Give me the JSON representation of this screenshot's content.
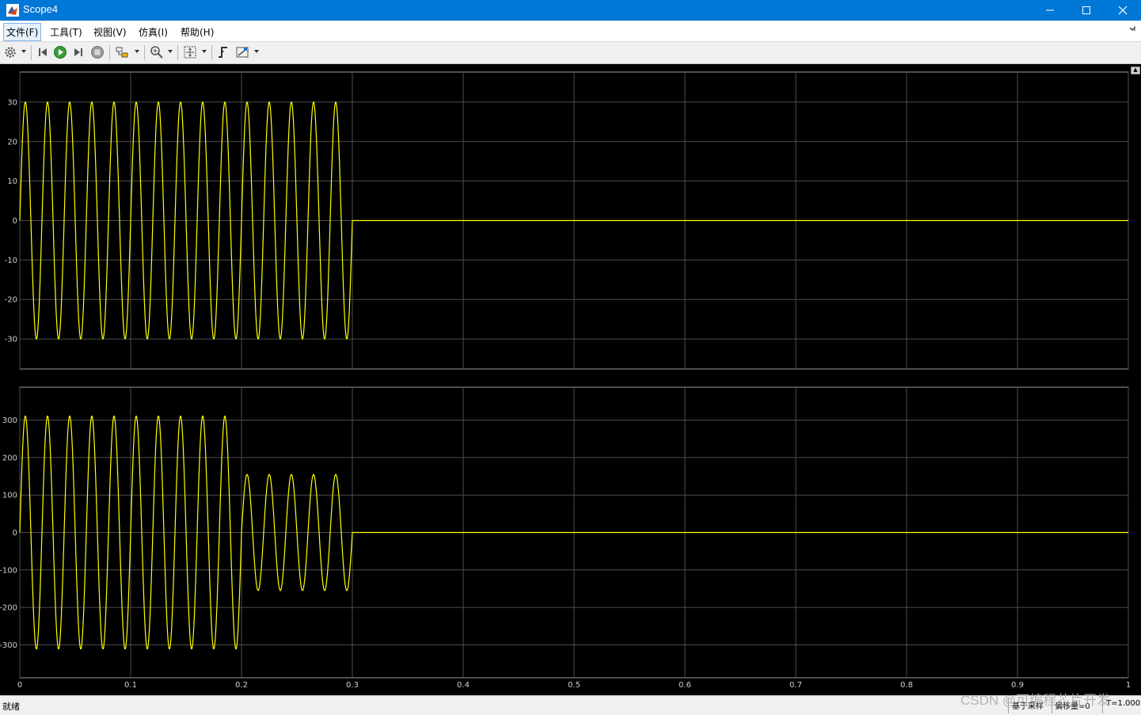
{
  "window": {
    "title": "Scope4"
  },
  "menu": [
    {
      "label": "文件(F)"
    },
    {
      "label": "工具(T)"
    },
    {
      "label": "视图(V)"
    },
    {
      "label": "仿真(I)"
    },
    {
      "label": "帮助(H)"
    }
  ],
  "toolbar": {
    "icons": [
      "gear-icon",
      "step-back-icon",
      "run-icon",
      "step-forward-icon",
      "stop-icon",
      "highlight-block-icon",
      "zoom-icon",
      "fit-to-view-icon",
      "triggers-icon",
      "measurements-icon"
    ]
  },
  "colors": {
    "signal": "#ffff00",
    "plot_bg": "#000000",
    "grid": "#4d4d4d",
    "axis_text": "#d0d0d0",
    "titlebar": "#0078d7"
  },
  "plots": [
    {
      "x_ticks": [
        "0",
        "0.1",
        "0.2",
        "0.3",
        "0.4",
        "0.5",
        "0.6",
        "0.7",
        "0.8",
        "0.9",
        "1"
      ],
      "y_ticks": [
        "30",
        "20",
        "10",
        "0",
        "-10",
        "-20",
        "-30"
      ],
      "xlim": [
        0,
        1
      ],
      "ylim": [
        -37.6,
        37.6
      ],
      "grid": true,
      "signal": {
        "frequency_hz": 50,
        "segments": [
          {
            "t0": 0,
            "t1": 0.3,
            "amplitude": 30
          }
        ],
        "zero_after": 0.3
      }
    },
    {
      "x_ticks": [
        "0",
        "0.1",
        "0.2",
        "0.3",
        "0.4",
        "0.5",
        "0.6",
        "0.7",
        "0.8",
        "0.9",
        "1"
      ],
      "y_ticks": [
        "300",
        "200",
        "100",
        "0",
        "-100",
        "-200",
        "-300"
      ],
      "xlim": [
        0,
        1
      ],
      "ylim": [
        -388,
        388
      ],
      "grid": true,
      "signal": {
        "frequency_hz": 50,
        "segments": [
          {
            "t0": 0,
            "t1": 0.2,
            "amplitude": 311
          },
          {
            "t0": 0.2,
            "t1": 0.3,
            "amplitude": 155
          }
        ],
        "zero_after": 0.3
      }
    }
  ],
  "status": {
    "left": "就绪",
    "mode": "基于采样",
    "offset": "偏移量=0",
    "time": "T=1.000"
  },
  "watermark": "CSDN @可编程芯片开发"
}
